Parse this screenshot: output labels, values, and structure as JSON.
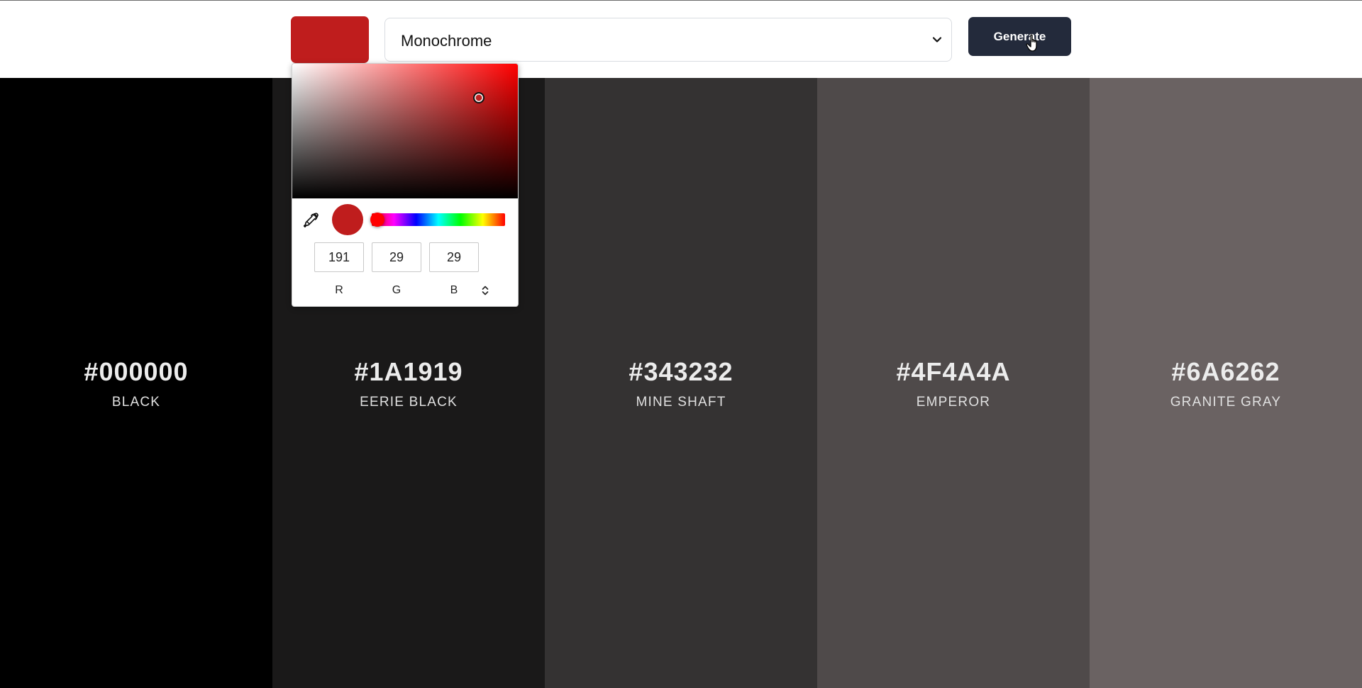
{
  "toolbar": {
    "base_color": "#BF1D1D",
    "scheme_select": {
      "selected": "Monochrome"
    },
    "generate_label": "Generate",
    "generate_bg": "#232A3B"
  },
  "picker": {
    "preview_color": "#BF1D1D",
    "rgb": {
      "r": "191",
      "g": "29",
      "b": "29"
    },
    "labels": {
      "r": "R",
      "g": "G",
      "b": "B"
    }
  },
  "palette": [
    {
      "hex": "#000000",
      "name": "BLACK",
      "bg": "#000000"
    },
    {
      "hex": "#1A1919",
      "name": "EERIE BLACK",
      "bg": "#1A1919"
    },
    {
      "hex": "#343232",
      "name": "MINE SHAFT",
      "bg": "#343232"
    },
    {
      "hex": "#4F4A4A",
      "name": "EMPEROR",
      "bg": "#4F4A4A"
    },
    {
      "hex": "#6A6262",
      "name": "GRANITE GRAY",
      "bg": "#6A6262"
    }
  ]
}
